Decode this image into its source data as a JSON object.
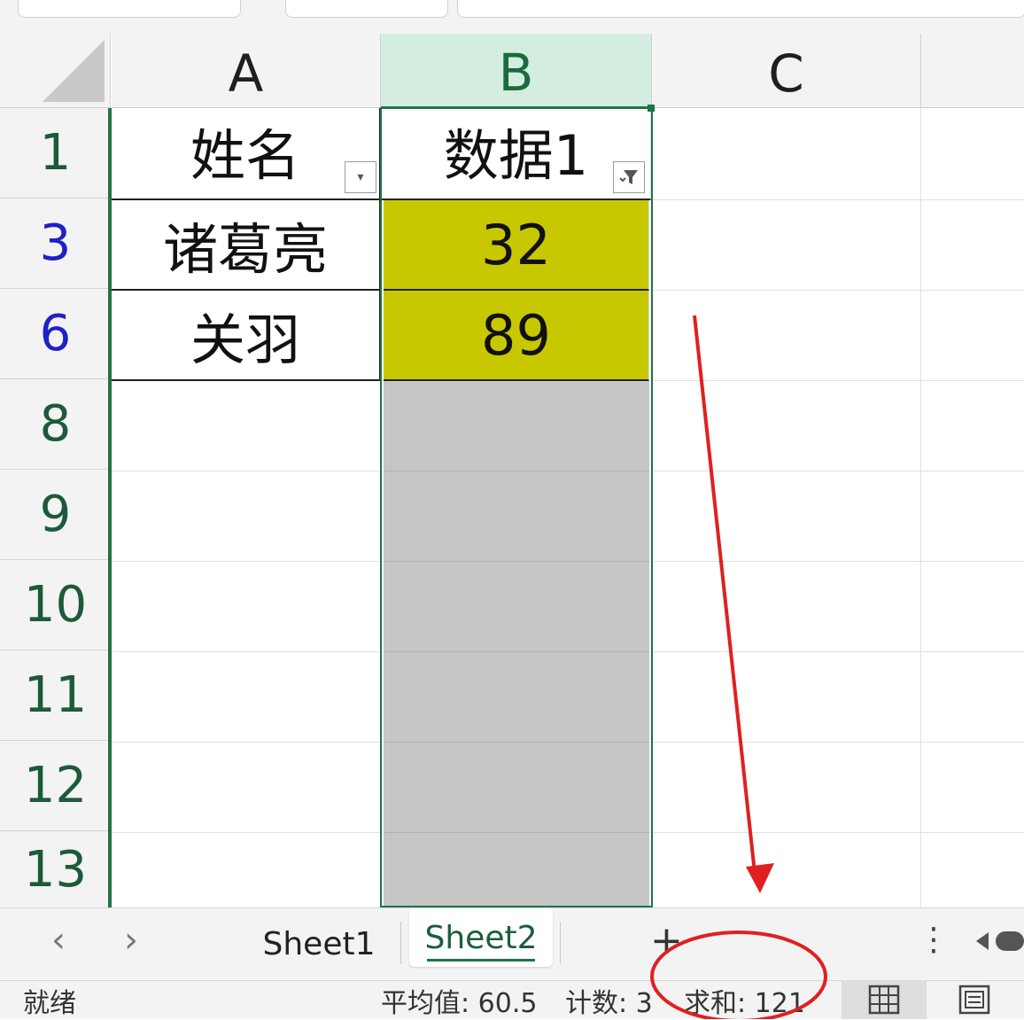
{
  "columns": [
    {
      "label": "A",
      "selected": false
    },
    {
      "label": "B",
      "selected": true
    },
    {
      "label": "C",
      "selected": false
    }
  ],
  "rows": [
    {
      "number": "1",
      "a": "姓名",
      "b": "数据1"
    },
    {
      "number": "3",
      "a": "诸葛亮",
      "b": "32"
    },
    {
      "number": "6",
      "a": "关羽",
      "b": "89"
    },
    {
      "number": "8",
      "a": "",
      "b": ""
    },
    {
      "number": "9",
      "a": "",
      "b": ""
    },
    {
      "number": "10",
      "a": "",
      "b": ""
    },
    {
      "number": "11",
      "a": "",
      "b": ""
    },
    {
      "number": "12",
      "a": "",
      "b": ""
    },
    {
      "number": "13",
      "a": "",
      "b": ""
    }
  ],
  "filter_a_icon": "dropdown-arrow-icon",
  "filter_b_icon": "filter-active-icon",
  "sheet_tabs": {
    "prev_label": "‹",
    "next_label": "›",
    "tabs": [
      {
        "label": "Sheet1",
        "active": false
      },
      {
        "label": "Sheet2",
        "active": true
      }
    ],
    "add_label": "+",
    "more_label": "⋮"
  },
  "status": {
    "ready": "就绪",
    "average": "平均值: 60.5",
    "count": "计数: 3",
    "sum": "求和: 121"
  },
  "colors": {
    "accent_green": "#217346",
    "highlight_yellow": "#c8c800",
    "annotation_red": "#e02020"
  }
}
